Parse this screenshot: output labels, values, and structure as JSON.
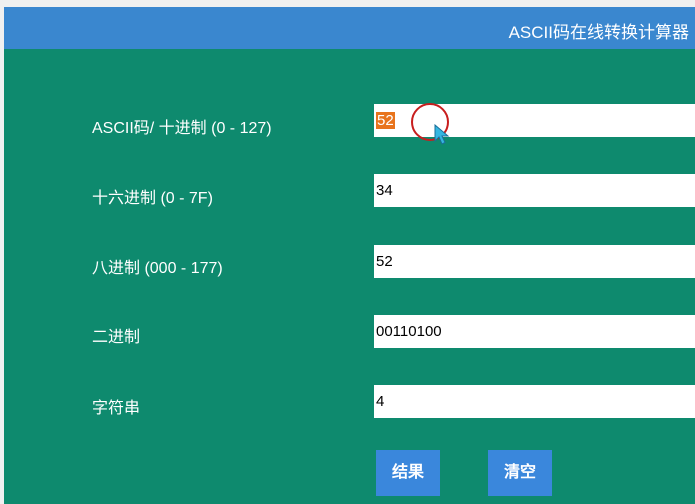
{
  "window": {
    "title": "ASCII码在线转换计算器"
  },
  "form": {
    "ascii_decimal": {
      "label": "ASCII码/ 十进制 (0 - 127)",
      "value": "52"
    },
    "hexadecimal": {
      "label": "十六进制 (0 - 7F)",
      "value": "34"
    },
    "octal": {
      "label": "八进制 (000 - 177)",
      "value": "52"
    },
    "binary": {
      "label": "二进制",
      "value": "00110100"
    },
    "string": {
      "label": "字符串",
      "value": "4"
    }
  },
  "buttons": {
    "result_label": "结果",
    "clear_label": "清空"
  },
  "icons": {
    "cursor": "mouse-pointer-icon",
    "click_highlight": "click-ring-icon"
  },
  "colors": {
    "background": "#0e8a6e",
    "titlebar": "#3a87cf",
    "button": "#3a87dc",
    "selection": "#e8741d",
    "click_ring": "#c81e1e"
  }
}
